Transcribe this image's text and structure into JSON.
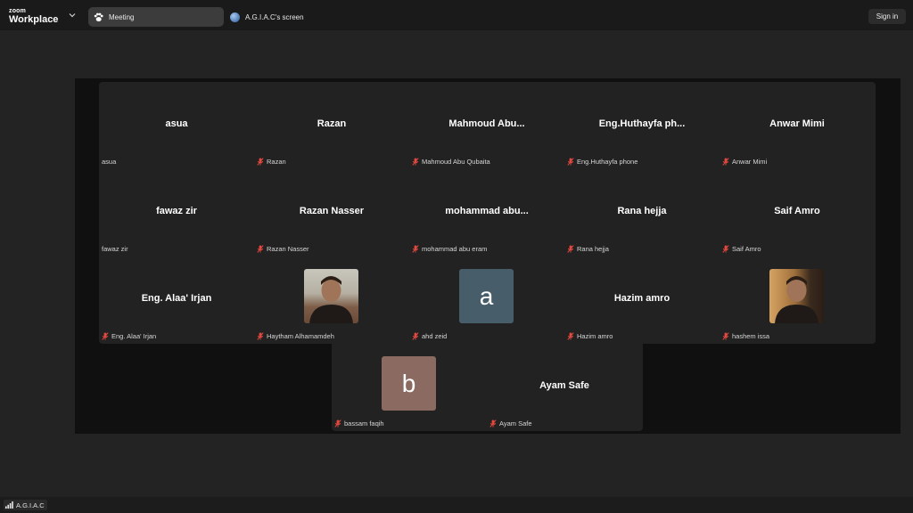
{
  "app": {
    "logo_line1": "zoom",
    "logo_line2": "Workplace"
  },
  "tabs": [
    {
      "label": "Meeting",
      "icon": "paw-icon"
    },
    {
      "label": "A.G.I.A.C's screen",
      "icon": "globe-avatar-icon"
    }
  ],
  "header": {
    "sign_in": "Sign in"
  },
  "participants": [
    {
      "big": "asua",
      "label": "asua",
      "muted": false
    },
    {
      "big": "Razan",
      "label": "Razan",
      "muted": true
    },
    {
      "big": "Mahmoud  Abu...",
      "label": "Mahmoud Abu Qubaita",
      "muted": true
    },
    {
      "big": "Eng.Huthayfa  ph...",
      "label": "Eng.Huthayfa phone",
      "muted": true
    },
    {
      "big": "Anwar Mimi",
      "label": "Anwar Mimi",
      "muted": true
    },
    {
      "big": "fawaz zir",
      "label": "fawaz zir",
      "muted": false
    },
    {
      "big": "Razan Nasser",
      "label": "Razan Nasser",
      "muted": true
    },
    {
      "big": "mohammad  abu...",
      "label": "mohammad abu eram",
      "muted": true
    },
    {
      "big": "Rana hejja",
      "label": "Rana hejja",
      "muted": true
    },
    {
      "big": "Saif Amro",
      "label": "Saif Amro",
      "muted": true
    },
    {
      "big": "Eng. Alaa' Irjan",
      "label": "Eng. Alaa' Irjan",
      "muted": true
    },
    {
      "big": "",
      "label": "Haytham Alhamamdeh",
      "muted": true,
      "avatar": "photo1"
    },
    {
      "big": "",
      "label": "ahd zeid",
      "muted": true,
      "avatar": "letter-a",
      "letter": "a"
    },
    {
      "big": "Hazim amro",
      "label": "Hazim amro",
      "muted": true
    },
    {
      "big": "",
      "label": "hashem issa",
      "muted": true,
      "avatar": "photo2"
    },
    {
      "big": "",
      "label": "bassam faqih",
      "muted": true,
      "avatar": "letter-b",
      "letter": "b"
    },
    {
      "big": "Ayam Safe",
      "label": "Ayam Safe",
      "muted": true
    }
  ],
  "footer": {
    "presenter": "A.G.I.A.C"
  },
  "colors": {
    "muted_mic": "#e5483e",
    "avatar_a": "#475d6a",
    "avatar_b": "#8a6a61"
  }
}
